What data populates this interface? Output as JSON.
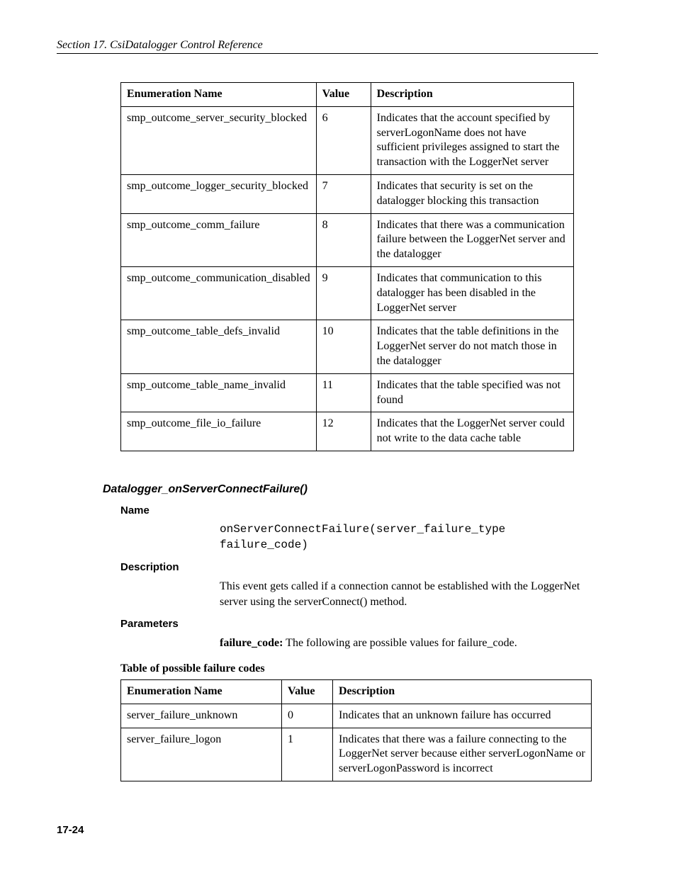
{
  "header": "Section 17.  CsiDatalogger Control Reference",
  "table1": {
    "headers": {
      "enum": "Enumeration Name",
      "value": "Value",
      "desc": "Description"
    },
    "rows": [
      {
        "enum": "smp_outcome_server_security_blocked",
        "value": "6",
        "desc": "Indicates that the account specified by serverLogonName does not have sufficient privileges assigned to start the transaction with the LoggerNet server"
      },
      {
        "enum": "smp_outcome_logger_security_blocked",
        "value": "7",
        "desc": "Indicates that security is set on the datalogger blocking this transaction"
      },
      {
        "enum": "smp_outcome_comm_failure",
        "value": "8",
        "desc": "Indicates that there was a communication failure between the LoggerNet server and the datalogger"
      },
      {
        "enum": "smp_outcome_communication_disabled",
        "value": "9",
        "desc": "Indicates that communication to this datalogger has been disabled in the LoggerNet server"
      },
      {
        "enum": "smp_outcome_table_defs_invalid",
        "value": "10",
        "desc": "Indicates that the table definitions in the LoggerNet server do not match those in the datalogger"
      },
      {
        "enum": "smp_outcome_table_name_invalid",
        "value": "11",
        "desc": "Indicates that the table specified was not found"
      },
      {
        "enum": "smp_outcome_file_io_failure",
        "value": "12",
        "desc": "Indicates that the LoggerNet server could not write to the data cache table"
      }
    ]
  },
  "section": {
    "title": "Datalogger_onServerConnectFailure()",
    "name_label": "Name",
    "signature": "onServerConnectFailure(server_failure_type failure_code)",
    "desc_label": "Description",
    "desc_text": "This event gets called if a connection cannot be established with the LoggerNet server using the serverConnect() method.",
    "params_label": "Parameters",
    "param_name": "failure_code:",
    "param_text": " The following are possible values for failure_code.",
    "table_caption": "Table of possible failure codes"
  },
  "table2": {
    "headers": {
      "enum": "Enumeration Name",
      "value": "Value",
      "desc": "Description"
    },
    "rows": [
      {
        "enum": "server_failure_unknown",
        "value": "0",
        "desc": "Indicates that an unknown failure has occurred"
      },
      {
        "enum": "server_failure_logon",
        "value": "1",
        "desc": "Indicates that there was a failure connecting to the LoggerNet server because either serverLogonName or serverLogonPassword is incorrect"
      }
    ]
  },
  "page_num": "17-24"
}
